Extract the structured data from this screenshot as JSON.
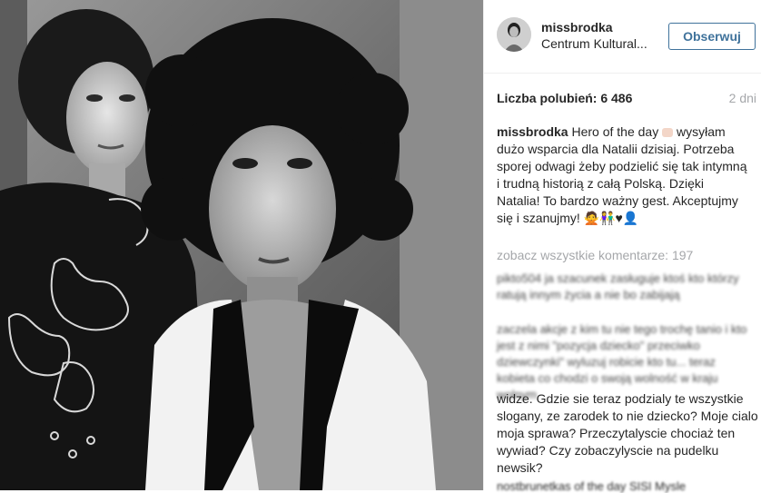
{
  "header": {
    "username": "missbrodka",
    "location": "Centrum Kultural...",
    "follow_label": "Obserwuj"
  },
  "stats": {
    "likes": "Liczba polubień: 6 486",
    "age": "2 dni"
  },
  "caption": {
    "username": "missbrodka",
    "text": "Hero of the day",
    "text2": "wysyłam dużo wsparcia dla Natalii dzisiaj. Potrzeba sporej odwagi żeby podzielić się tak intymną i trudną historią z całą Polską. Dzięki Natalia! To bardzo ważny gest. Akceptujmy się i szanujmy! 🙅👫♥👤"
  },
  "comments": {
    "view_all": "zobacz wszystkie komentarze: 197",
    "blurred_1": "pikto504 ja szacunek zasługuje ktoś kto którzy ratują innym życia a nie bo zabijają",
    "blurred_2": "zaczela akcje z kim tu nie tego trochę tanio i kto jest z nimi \"pozycja dziecko\" przeciwko dziewczynki\" wyluzuj robicie kto tu... teraz kobieta co chodzi o swoją wolność w kraju wolnym",
    "visible": "widze. Gdzie sie teraz podzialy te wszystkie slogany, ze zarodek to nie dziecko? Moje cialo moja sprawa? Przeczytalyscie chociaż ten wywiad? Czy zobaczylyscie na pudelku newsik?",
    "cut": "nostbrunetkas of the day SISI Mysle"
  },
  "colors": {
    "accent": "#3f729b",
    "muted": "#a5a7aa",
    "text": "#262626"
  }
}
